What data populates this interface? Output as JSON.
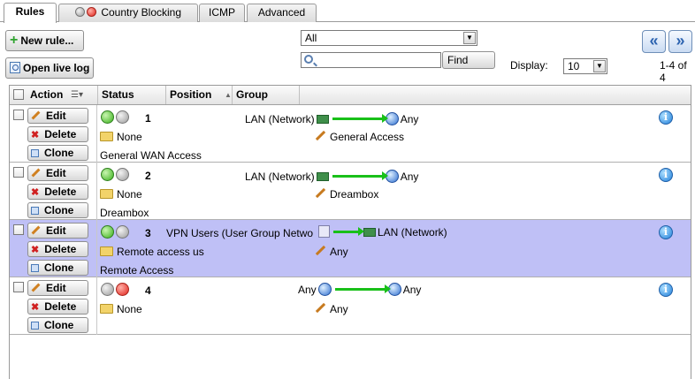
{
  "tabs": [
    {
      "label": "Rules",
      "active": true
    },
    {
      "label": "Country Blocking",
      "active": false
    },
    {
      "label": "ICMP",
      "active": false
    },
    {
      "label": "Advanced",
      "active": false
    }
  ],
  "toolbar": {
    "new_rule_label": "New rule...",
    "open_live_log_label": "Open live log",
    "filter_value": "All",
    "search_value": "",
    "find_label": "Find",
    "display_label": "Display:",
    "display_value": "10",
    "range_text": "1-4 of 4"
  },
  "grid": {
    "columns": [
      "Action",
      "Status",
      "Position",
      "Group"
    ]
  },
  "buttons": {
    "edit": "Edit",
    "delete": "Delete",
    "clone": "Clone"
  },
  "rows": [
    {
      "status": [
        "green",
        "gray"
      ],
      "position": "1",
      "source": "LAN (Network)",
      "destination": "Any",
      "group": "None",
      "service": "General Access",
      "comment": "General WAN Access",
      "selected": false
    },
    {
      "status": [
        "green",
        "gray"
      ],
      "position": "2",
      "source": "LAN (Network)",
      "destination": "Any",
      "group": "None",
      "service": "Dreambox",
      "comment": "Dreambox",
      "selected": false
    },
    {
      "status": [
        "green",
        "gray"
      ],
      "position": "3",
      "source": "VPN Users (User Group Netwo",
      "destination": "LAN (Network)",
      "group": "Remote access us",
      "service": "Any",
      "comment": "Remote Access",
      "selected": true
    },
    {
      "status": [
        "gray",
        "red"
      ],
      "position": "4",
      "source": "Any",
      "destination": "Any",
      "group": "None",
      "service": "Any",
      "comment": "",
      "selected": false
    }
  ]
}
